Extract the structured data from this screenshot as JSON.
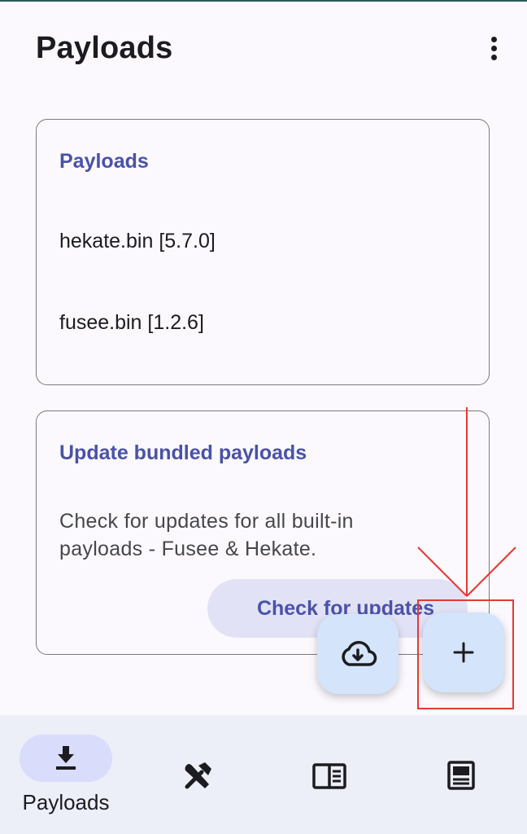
{
  "header": {
    "title": "Payloads",
    "menu_icon": "more-vert-icon"
  },
  "payloads_card": {
    "title": "Payloads",
    "items": [
      "hekate.bin [5.7.0]",
      "fusee.bin [1.2.6]"
    ]
  },
  "update_card": {
    "title": "Update bundled payloads",
    "description": "Check for updates for all built-in payloads - Fusee & Hekate.",
    "button_label": "Check for updates"
  },
  "fabs": {
    "download_icon": "cloud-download-icon",
    "add_icon": "add-icon"
  },
  "bottom_nav": {
    "items": [
      {
        "label": "Payloads",
        "icon": "download-icon",
        "selected": true
      },
      {
        "label": "",
        "icon": "tools-icon",
        "selected": false
      },
      {
        "label": "",
        "icon": "sidebar-panel-icon",
        "selected": false
      },
      {
        "label": "",
        "icon": "article-icon",
        "selected": false
      }
    ]
  },
  "colors": {
    "accent": "#4a52a8",
    "fab": "#d3e4fb",
    "nav_bg": "#eceef8",
    "annotation": "#e53935"
  }
}
